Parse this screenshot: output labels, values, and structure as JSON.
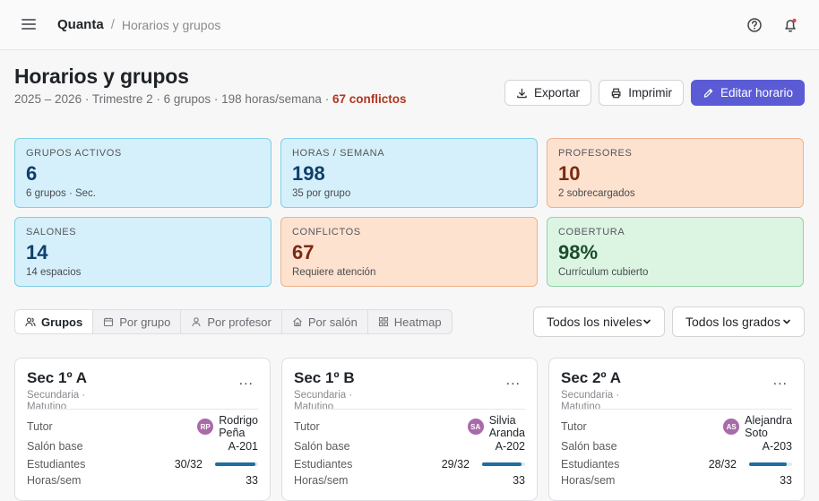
{
  "topbar": {
    "app": "Quanta",
    "separator": "/",
    "current": "Horarios y grupos"
  },
  "header": {
    "title": "Horarios y grupos",
    "subtitle": "2025 – 2026 · Trimestre 2 · 6 grupos · 198 horas/semana · ",
    "conflicts": "67 conflictos"
  },
  "actions": {
    "export": "Exportar",
    "print": "Imprimir",
    "edit": "Editar horario"
  },
  "stats": [
    {
      "label": "GRUPOS ACTIVOS",
      "value": "6",
      "sub": "6 grupos · Sec."
    },
    {
      "label": "HORAS / SEMANA",
      "value": "198",
      "sub": "35 por grupo"
    },
    {
      "label": "PROFESORES",
      "value": "10",
      "sub": "2 sobrecargados"
    },
    {
      "label": "SALONES",
      "value": "14",
      "sub": "14 espacios"
    },
    {
      "label": "CONFLICTOS",
      "value": "67",
      "sub": "Requiere atención"
    },
    {
      "label": "COBERTURA",
      "value": "98%",
      "sub": "Currículum cubierto"
    }
  ],
  "tabs": [
    "Grupos",
    "Por grupo",
    "Por profesor",
    "Por salón",
    "Heatmap"
  ],
  "filters": {
    "level": "Todos los niveles",
    "grade": "Todos los grados"
  },
  "card_labels": {
    "tutor": "Tutor",
    "room": "Salón base",
    "students": "Estudiantes",
    "hours": "Horas/sem",
    "more": "..."
  },
  "cards": [
    {
      "name": "Sec 1º A",
      "meta": "Secundaria · Matutino",
      "initials": "RP",
      "tutor_first": "Rodrigo",
      "tutor_last": "Peña",
      "room": "A-201",
      "students": "30/32",
      "fill": 0.94,
      "hours": "33"
    },
    {
      "name": "Sec 1º B",
      "meta": "Secundaria · Matutino",
      "initials": "SA",
      "tutor_first": "Silvia",
      "tutor_last": "Aranda",
      "room": "A-202",
      "students": "29/32",
      "fill": 0.91,
      "hours": "33"
    },
    {
      "name": "Sec 2º A",
      "meta": "Secundaria · Matutino",
      "initials": "AS",
      "tutor_first": "Alejandra",
      "tutor_last": "Soto",
      "room": "A-203",
      "students": "28/32",
      "fill": 0.88,
      "hours": "33"
    }
  ],
  "colors": {
    "accent": "#5b5bd6",
    "conflict": "#b0361f",
    "avatar": "#a86ba8",
    "bar": "#1d6fa3"
  }
}
